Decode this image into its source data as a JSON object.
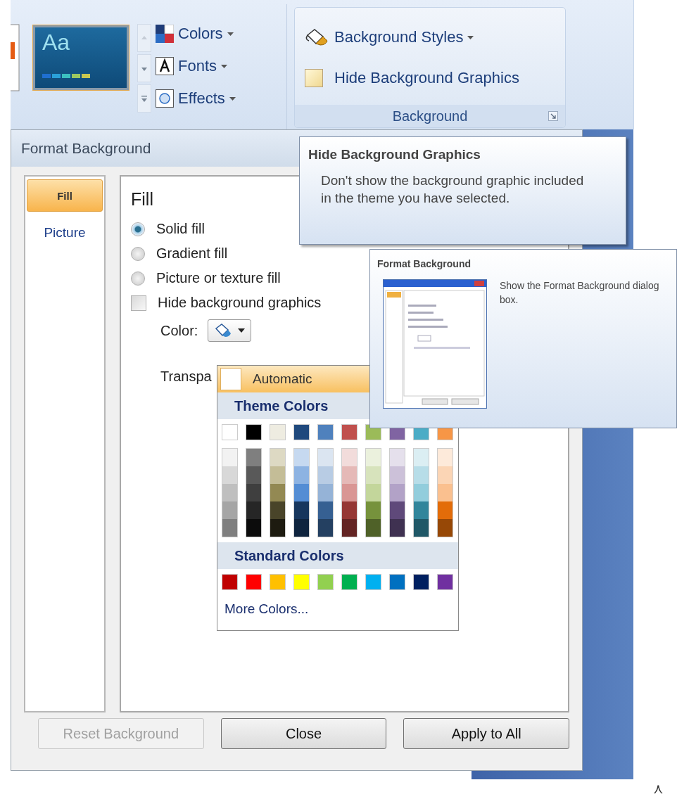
{
  "ribbon": {
    "theme_thumbnail": {
      "label": "Aa",
      "selected": true
    },
    "theme_commands": [
      {
        "label": "Colors",
        "kind": "colors"
      },
      {
        "label": "Fonts",
        "kind": "fonts"
      },
      {
        "label": "Effects",
        "kind": "effects"
      }
    ],
    "background_group": {
      "styles_button": "Background Styles",
      "hide_graphics": {
        "label": "Hide Background Graphics",
        "checked": false
      },
      "label": "Background"
    }
  },
  "dialog": {
    "title": "Format Background",
    "nav": [
      {
        "label": "Fill",
        "selected": true
      },
      {
        "label": "Picture",
        "selected": false
      }
    ],
    "heading": "Fill",
    "fill_options": [
      {
        "label": "Solid fill",
        "selected": true
      },
      {
        "label": "Gradient fill",
        "selected": false
      },
      {
        "label": "Picture or texture fill",
        "selected": false
      }
    ],
    "hide_graphics": {
      "label": "Hide background graphics",
      "checked": false
    },
    "color_label": "Color:",
    "transparency_label": "Transpa",
    "buttons": [
      {
        "label": "Reset Background",
        "disabled": true
      },
      {
        "label": "Close",
        "disabled": false
      },
      {
        "label": "Apply to All",
        "disabled": false
      }
    ]
  },
  "color_menu": {
    "automatic": "Automatic",
    "theme_header": "Theme Colors",
    "theme_colors": [
      {
        "color": "#ffffff",
        "shades": [
          {
            "color": "#f2f2f2"
          },
          {
            "color": "#d8d8d8"
          },
          {
            "color": "#bfbfbf"
          },
          {
            "color": "#a5a5a5"
          },
          {
            "color": "#7f7f7f"
          }
        ]
      },
      {
        "color": "#000000",
        "shades": [
          {
            "color": "#7f7f7f"
          },
          {
            "color": "#595959"
          },
          {
            "color": "#3f3f3f"
          },
          {
            "color": "#262626"
          },
          {
            "color": "#0c0c0c"
          }
        ]
      },
      {
        "color": "#eeece1",
        "shades": [
          {
            "color": "#ddd9c3"
          },
          {
            "color": "#c4bd97"
          },
          {
            "color": "#938953"
          },
          {
            "color": "#494429"
          },
          {
            "color": "#1d1b10"
          }
        ]
      },
      {
        "color": "#1f497d",
        "shades": [
          {
            "color": "#c6d9f0"
          },
          {
            "color": "#8db3e2"
          },
          {
            "color": "#548dd4"
          },
          {
            "color": "#17365d"
          },
          {
            "color": "#0f243e"
          }
        ]
      },
      {
        "color": "#4f81bd",
        "shades": [
          {
            "color": "#dbe5f1"
          },
          {
            "color": "#b8cce4"
          },
          {
            "color": "#95b3d7"
          },
          {
            "color": "#366092"
          },
          {
            "color": "#244061"
          }
        ]
      },
      {
        "color": "#c0504d",
        "shades": [
          {
            "color": "#f2dcdb"
          },
          {
            "color": "#e5b9b7"
          },
          {
            "color": "#d99694"
          },
          {
            "color": "#953734"
          },
          {
            "color": "#632423"
          }
        ]
      },
      {
        "color": "#9bbb59",
        "shades": [
          {
            "color": "#ebf1dd"
          },
          {
            "color": "#d7e3bc"
          },
          {
            "color": "#c3d69b"
          },
          {
            "color": "#76923c"
          },
          {
            "color": "#4f6128"
          }
        ]
      },
      {
        "color": "#8064a2",
        "shades": [
          {
            "color": "#e5e0ec"
          },
          {
            "color": "#ccc1d9"
          },
          {
            "color": "#b2a2c7"
          },
          {
            "color": "#5f497a"
          },
          {
            "color": "#3f3151"
          }
        ]
      },
      {
        "color": "#4bacc6",
        "shades": [
          {
            "color": "#dbeef3"
          },
          {
            "color": "#b7dde8"
          },
          {
            "color": "#92cddc"
          },
          {
            "color": "#31859b"
          },
          {
            "color": "#205867"
          }
        ]
      },
      {
        "color": "#f79646",
        "shades": [
          {
            "color": "#fdeada"
          },
          {
            "color": "#fbd5b5"
          },
          {
            "color": "#fac08f"
          },
          {
            "color": "#e36c09"
          },
          {
            "color": "#974806"
          }
        ]
      }
    ],
    "standard_header": "Standard Colors",
    "standard_colors": [
      {
        "color": "#c00000"
      },
      {
        "color": "#ff0000"
      },
      {
        "color": "#ffc000"
      },
      {
        "color": "#ffff00"
      },
      {
        "color": "#92d050"
      },
      {
        "color": "#00b050"
      },
      {
        "color": "#00b0f0"
      },
      {
        "color": "#0070c0"
      },
      {
        "color": "#002060"
      },
      {
        "color": "#7030a0"
      }
    ],
    "more": "More Colors..."
  },
  "tooltip": {
    "title": "Hide Background Graphics",
    "body": "Don't show the background graphic included in the theme you have selected."
  },
  "supertip": {
    "title": "Format Background",
    "body": "Show the Format Background dialog box."
  },
  "corner_mark": "⋏"
}
